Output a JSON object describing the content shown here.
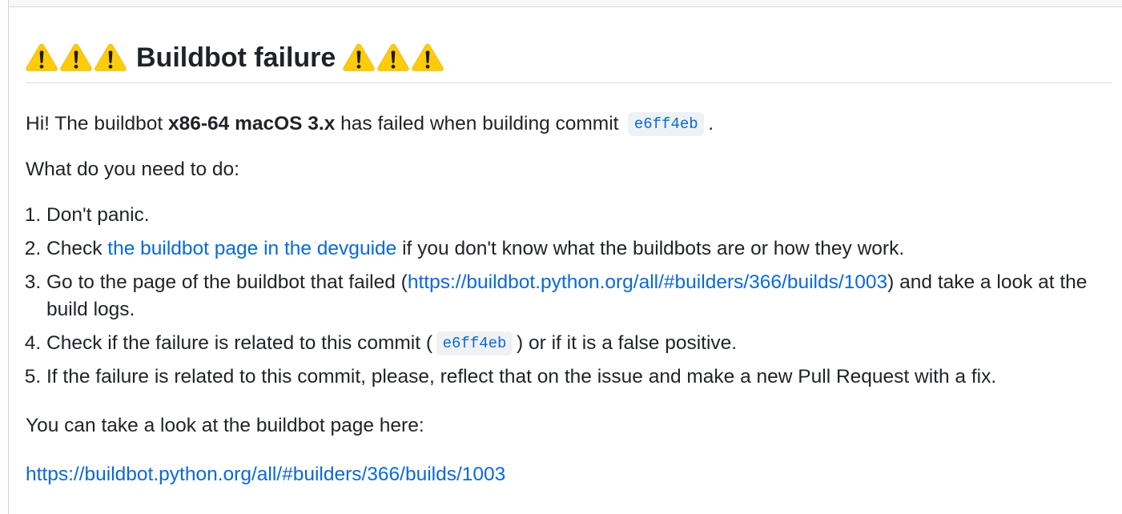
{
  "colors": {
    "text": "#1f2328",
    "link": "#0969da",
    "code_bg": "#eff2f5",
    "divider": "#d8dee4",
    "border": "#d0d7de",
    "strip_bg": "#f6f8fa",
    "warning": "#ffcb0b"
  },
  "comment": {
    "heading": {
      "leading_icons": [
        "warning-icon",
        "warning-icon",
        "warning-icon"
      ],
      "title": "Buildbot failure",
      "trailing_icons": [
        "warning-icon",
        "warning-icon",
        "warning-icon"
      ]
    },
    "intro": {
      "prefix": "Hi! The buildbot ",
      "builder": "x86-64 macOS 3.x",
      "middle": " has failed when building commit ",
      "commit": "e6ff4eb",
      "suffix": "."
    },
    "todo_heading": "What do you need to do:",
    "steps": [
      {
        "text": "Don't panic."
      },
      {
        "before": "Check ",
        "link": "the buildbot page in the devguide",
        "after": " if you don't know what the buildbots are or how they work."
      },
      {
        "before": "Go to the page of the buildbot that failed (",
        "link": "https://buildbot.python.org/all/#builders/366/builds/1003",
        "after": ") and take a look at the build logs."
      },
      {
        "before": "Check if the failure is related to this commit (",
        "commit": "e6ff4eb",
        "after": ") or if it is a false positive."
      },
      {
        "text": "If the failure is related to this commit, please, reflect that on the issue and make a new Pull Request with a fix."
      }
    ],
    "footer_text": "You can take a look at the buildbot page here:",
    "footer_link": "https://buildbot.python.org/all/#builders/366/builds/1003"
  }
}
